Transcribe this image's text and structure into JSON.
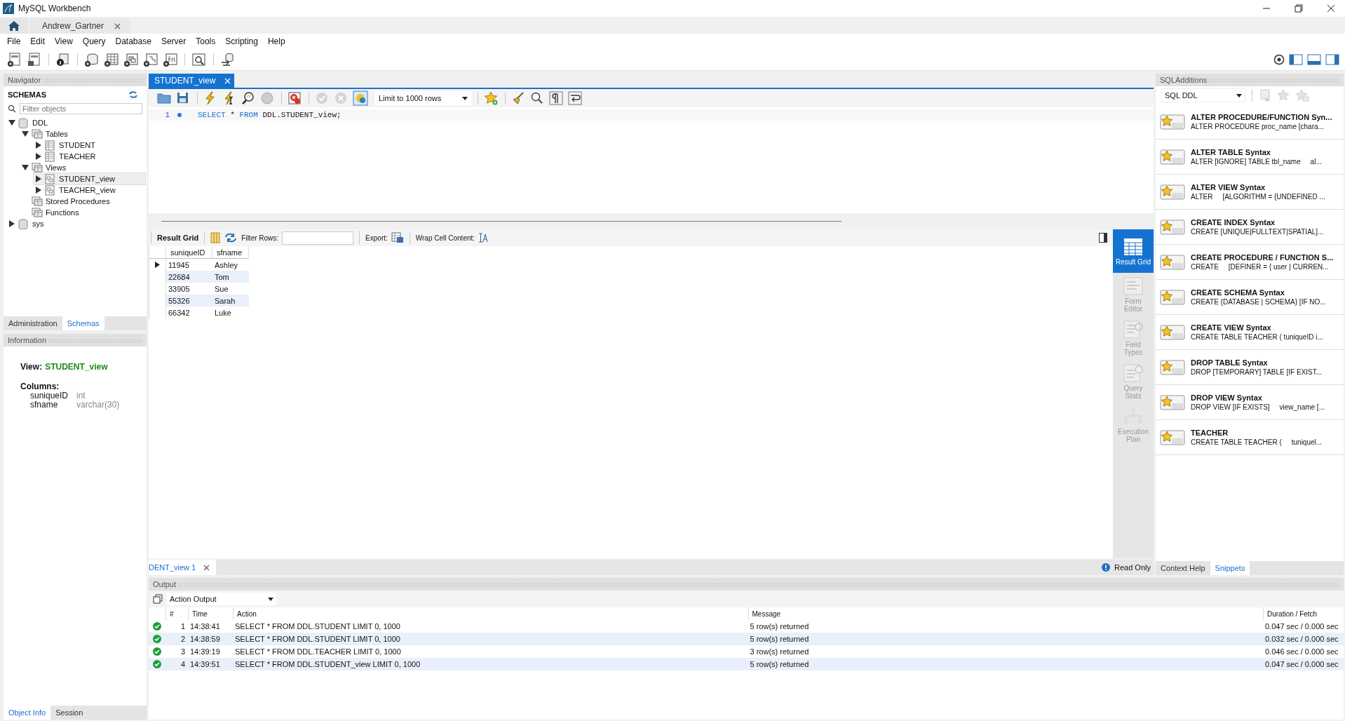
{
  "window": {
    "title": "MySQL Workbench"
  },
  "connection_tabs": [
    {
      "label": "Andrew_Gartner",
      "selected": true
    }
  ],
  "menu": [
    "File",
    "Edit",
    "View",
    "Query",
    "Database",
    "Server",
    "Tools",
    "Scripting",
    "Help"
  ],
  "navigator": {
    "title": "Navigator",
    "section": "SCHEMAS",
    "filter": {
      "placeholder": "Filter objects"
    },
    "tree": [
      {
        "label": "DDL",
        "kind": "schema",
        "expanded": true,
        "selected": false,
        "children": [
          {
            "label": "Tables",
            "kind": "folder",
            "expanded": true,
            "selected": false,
            "children": [
              {
                "label": "STUDENT",
                "kind": "table",
                "expanded": false,
                "selected": false
              },
              {
                "label": "TEACHER",
                "kind": "table",
                "expanded": false,
                "selected": false
              }
            ]
          },
          {
            "label": "Views",
            "kind": "folder",
            "expanded": true,
            "selected": false,
            "children": [
              {
                "label": "STUDENT_view",
                "kind": "view",
                "expanded": false,
                "selected": true
              },
              {
                "label": "TEACHER_view",
                "kind": "view",
                "expanded": false,
                "selected": false
              }
            ]
          },
          {
            "label": "Stored Procedures",
            "kind": "folder",
            "selected": false
          },
          {
            "label": "Functions",
            "kind": "folder",
            "selected": false
          }
        ]
      },
      {
        "label": "sys",
        "kind": "schema",
        "expanded": false,
        "selected": false
      }
    ],
    "tabs": [
      {
        "label": "Administration",
        "selected": false
      },
      {
        "label": "Schemas",
        "selected": true
      }
    ]
  },
  "information": {
    "title": "Information",
    "object_type": "View:",
    "object_name": "STUDENT_view",
    "columns_label": "Columns:",
    "columns": [
      {
        "name": "suniqueID",
        "type": "int"
      },
      {
        "name": "sfname",
        "type": "varchar(30)"
      }
    ],
    "tabs": [
      {
        "label": "Object Info",
        "selected": true
      },
      {
        "label": "Session",
        "selected": false
      }
    ]
  },
  "editor": {
    "tabs": [
      {
        "label": "STUDENT_view",
        "selected": true
      }
    ],
    "limit": "Limit to 1000 rows",
    "lines": [
      {
        "number": "1",
        "tokens": [
          {
            "text": "SELECT",
            "kind": "keyword"
          },
          {
            "text": " * ",
            "kind": "plain"
          },
          {
            "text": "FROM",
            "kind": "keyword"
          },
          {
            "text": " DDL.STUDENT_view;",
            "kind": "plain"
          }
        ]
      }
    ]
  },
  "result": {
    "label": "Result Grid",
    "filter_label": "Filter Rows:",
    "export_label": "Export:",
    "wrap_label": "Wrap Cell Content:",
    "columns": [
      "suniqueID",
      "sfname"
    ],
    "rows": [
      {
        "cells": [
          "11945",
          "Ashley"
        ],
        "current": true
      },
      {
        "cells": [
          "22684",
          "Tom"
        ],
        "current": false
      },
      {
        "cells": [
          "33905",
          "Sue"
        ],
        "current": false
      },
      {
        "cells": [
          "55326",
          "Sarah"
        ],
        "current": false
      },
      {
        "cells": [
          "66342",
          "Luke"
        ],
        "current": false
      }
    ],
    "side": [
      {
        "label": "Result Grid",
        "kind": "grid",
        "selected": true
      },
      {
        "label": "Form Editor",
        "kind": "form",
        "selected": false
      },
      {
        "label": "Field Types",
        "kind": "fields",
        "selected": false
      },
      {
        "label": "Query Stats",
        "kind": "stats",
        "selected": false
      },
      {
        "label": "Execution Plan",
        "kind": "plan",
        "selected": false
      }
    ],
    "tabs": [
      {
        "label": "DENT_view 1",
        "selected": true
      }
    ],
    "status": "Read Only"
  },
  "sql_additions": {
    "title": "SQLAdditions",
    "category": "SQL DDL",
    "snippets": [
      {
        "title": "ALTER PROCEDURE/FUNCTION Syn...",
        "body": "ALTER PROCEDURE proc_name [chara..."
      },
      {
        "title": "ALTER TABLE Syntax",
        "body": "ALTER [IGNORE] TABLE tbl_name     al..."
      },
      {
        "title": "ALTER VIEW Syntax",
        "body": "ALTER     [ALGORITHM = {UNDEFINED ..."
      },
      {
        "title": "CREATE INDEX Syntax",
        "body": "CREATE [UNIQUE|FULLTEXT|SPATIAL]..."
      },
      {
        "title": "CREATE PROCEDURE / FUNCTION S...",
        "body": "CREATE     [DEFINER = { user | CURREN..."
      },
      {
        "title": "CREATE SCHEMA Syntax",
        "body": "CREATE {DATABASE | SCHEMA} [IF NO..."
      },
      {
        "title": "CREATE VIEW Syntax",
        "body": "CREATE TABLE TEACHER ( tuniqueID i..."
      },
      {
        "title": "DROP TABLE Syntax",
        "body": "DROP [TEMPORARY] TABLE [IF EXIST..."
      },
      {
        "title": "DROP VIEW Syntax",
        "body": "DROP VIEW [IF EXISTS]     view_name [..."
      },
      {
        "title": "TEACHER",
        "body": "CREATE TABLE TEACHER (     tuniquel..."
      }
    ],
    "tabs": [
      {
        "label": "Context Help",
        "selected": false
      },
      {
        "label": "Snippets",
        "selected": true
      }
    ]
  },
  "output": {
    "title": "Output",
    "mode": "Action Output",
    "columns": [
      "#",
      "Time",
      "Action",
      "Message",
      "Duration / Fetch"
    ],
    "rows": [
      {
        "success": true,
        "number": "1",
        "time": "14:38:41",
        "action": "SELECT * FROM DDL.STUDENT LIMIT 0, 1000",
        "message": "5 row(s) returned",
        "duration": "0.047 sec / 0.000 sec"
      },
      {
        "success": true,
        "number": "2",
        "time": "14:38:59",
        "action": "SELECT * FROM DDL.STUDENT LIMIT 0, 1000",
        "message": "5 row(s) returned",
        "duration": "0.032 sec / 0.000 sec"
      },
      {
        "success": true,
        "number": "3",
        "time": "14:39:19",
        "action": "SELECT * FROM DDL.TEACHER LIMIT 0, 1000",
        "message": "3 row(s) returned",
        "duration": "0.046 sec / 0.000 sec"
      },
      {
        "success": true,
        "number": "4",
        "time": "14:39:51",
        "action": "SELECT * FROM DDL.STUDENT_view LIMIT 0, 1000",
        "message": "5 row(s) returned",
        "duration": "0.047 sec / 0.000 sec"
      }
    ]
  }
}
